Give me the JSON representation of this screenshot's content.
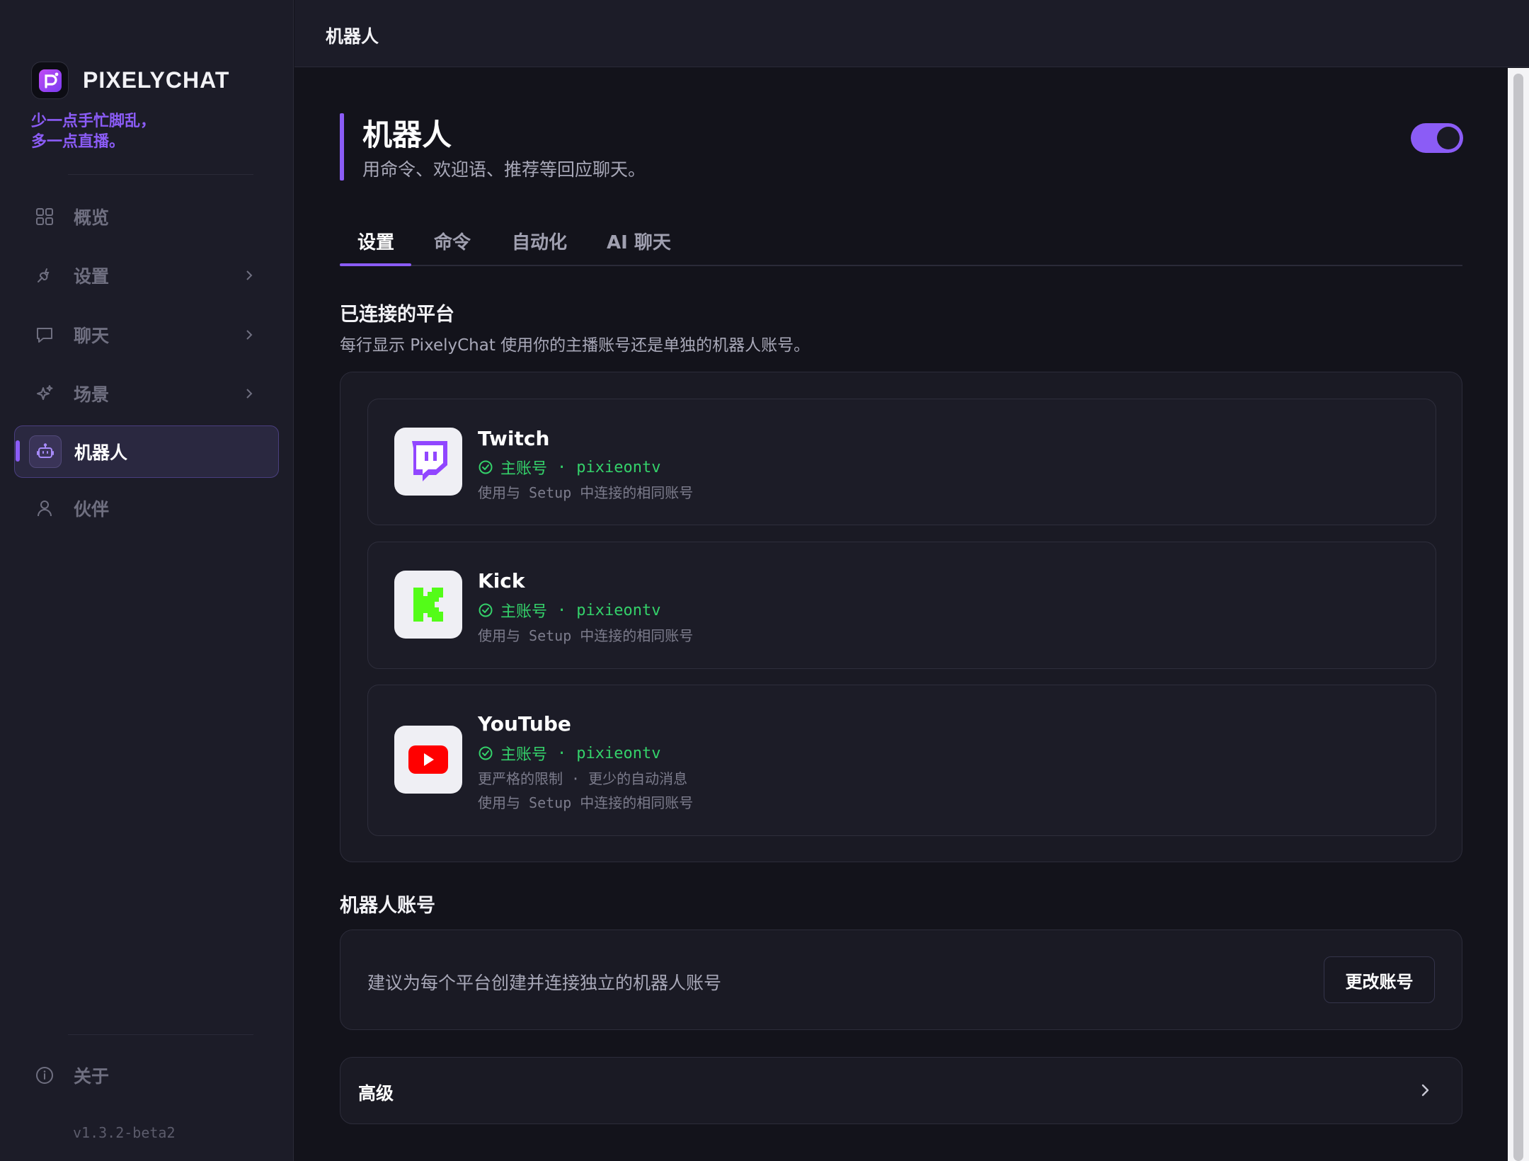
{
  "app": {
    "brand_name": "PIXELYCHAT",
    "tagline_line1": "少一点手忙脚乱，",
    "tagline_line2": "多一点直播。",
    "version": "v1.3.2-beta2"
  },
  "sidebar": {
    "items": [
      {
        "label": "概览",
        "icon": "grid-icon"
      },
      {
        "label": "设置",
        "icon": "plug-icon"
      },
      {
        "label": "聊天",
        "icon": "chat-bubble-icon"
      },
      {
        "label": "场景",
        "icon": "sparkle-icon"
      },
      {
        "label": "机器人",
        "icon": "robot-icon"
      },
      {
        "label": "伙伴",
        "icon": "user-icon"
      }
    ],
    "about_label": "关于"
  },
  "header": {
    "title": "机器人"
  },
  "page": {
    "title": "机器人",
    "subtitle": "用命令、欢迎语、推荐等回应聊天。",
    "enabled": true
  },
  "tabs": [
    {
      "label": "设置"
    },
    {
      "label": "命令"
    },
    {
      "label": "自动化"
    },
    {
      "label": "AI 聊天"
    }
  ],
  "platforms_section": {
    "title": "已连接的平台",
    "description": "每行显示 PixelyChat 使用你的主播账号还是单独的机器人账号。",
    "platforms": [
      {
        "name": "Twitch",
        "account_type": "主账号",
        "username": "pixieontv",
        "notes": [
          "使用与 Setup 中连接的相同账号"
        ]
      },
      {
        "name": "Kick",
        "account_type": "主账号",
        "username": "pixieontv",
        "notes": [
          "使用与 Setup 中连接的相同账号"
        ]
      },
      {
        "name": "YouTube",
        "account_type": "主账号",
        "username": "pixieontv",
        "notes": [
          "更严格的限制 · 更少的自动消息",
          "使用与 Setup 中连接的相同账号"
        ]
      }
    ]
  },
  "bot_account": {
    "title": "机器人账号",
    "description": "建议为每个平台创建并连接独立的机器人账号",
    "button_label": "更改账号"
  },
  "advanced": {
    "label": "高级"
  },
  "colors": {
    "accent": "#8b5cf6",
    "success": "#34d16a",
    "twitch": "#9146ff",
    "kick": "#53fc18",
    "youtube": "#ff0000"
  }
}
